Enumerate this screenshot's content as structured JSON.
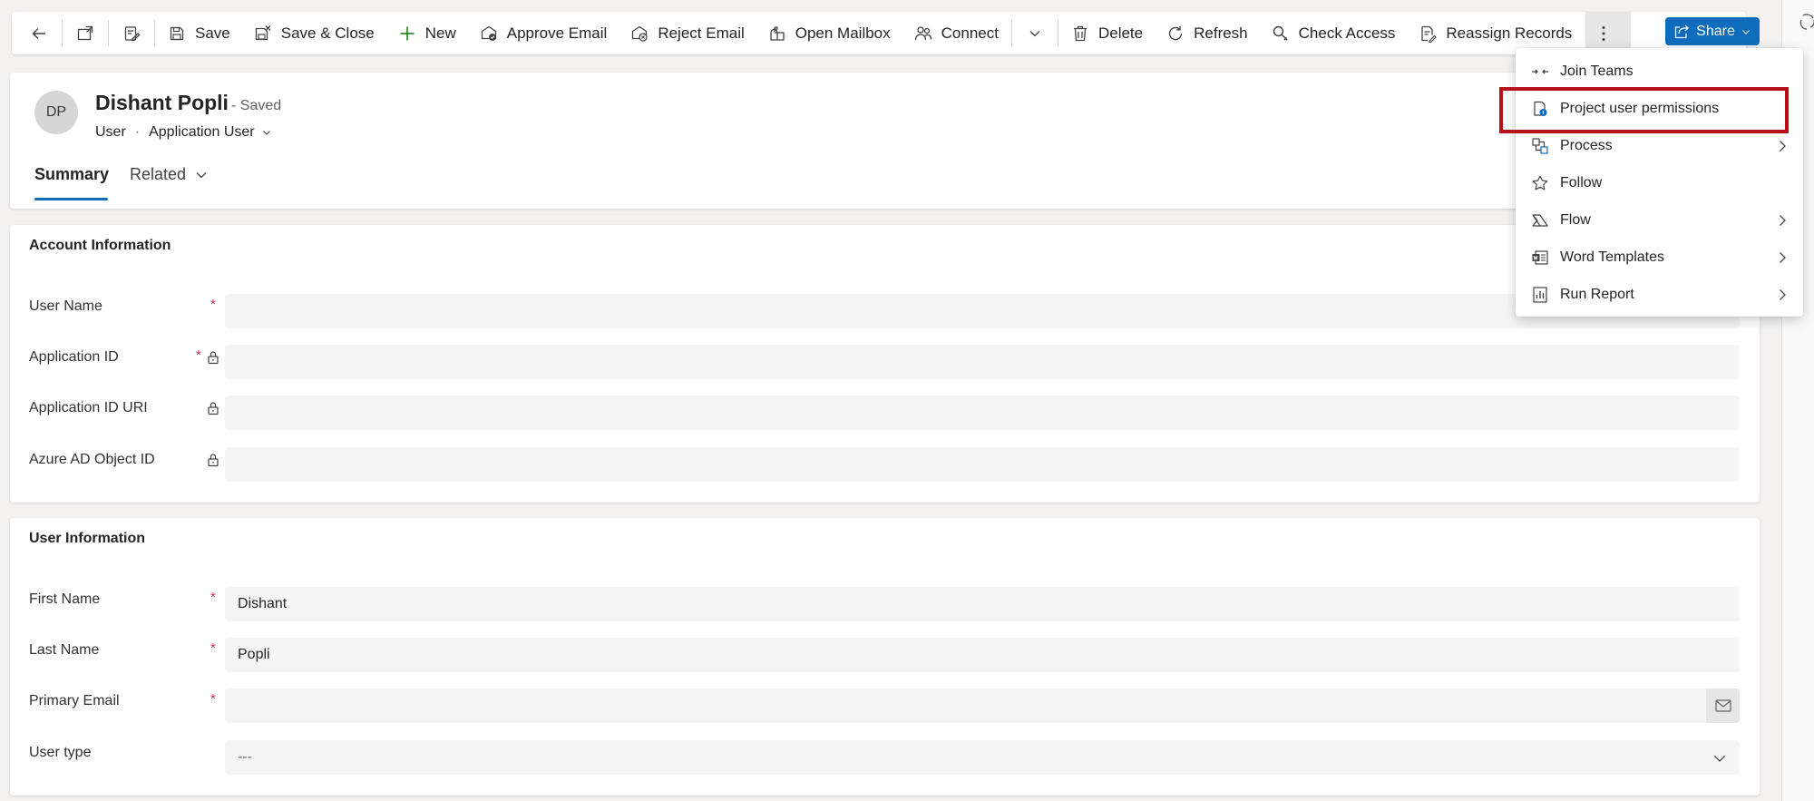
{
  "toolbar": {
    "save": "Save",
    "save_close": "Save & Close",
    "new": "New",
    "approve_email": "Approve Email",
    "reject_email": "Reject Email",
    "open_mailbox": "Open Mailbox",
    "connect": "Connect",
    "delete": "Delete",
    "refresh": "Refresh",
    "check_access": "Check Access",
    "reassign_records": "Reassign Records",
    "share": "Share"
  },
  "record": {
    "initials": "DP",
    "name": "Dishant Popli",
    "status": "- Saved",
    "entity": "User",
    "separator": "·",
    "form": "Application User"
  },
  "tabs": {
    "summary": "Summary",
    "related": "Related"
  },
  "account_section": {
    "title": "Account Information",
    "fields": [
      {
        "label": "User Name",
        "value": "",
        "required": true,
        "locked": false
      },
      {
        "label": "Application ID",
        "value": "",
        "required": true,
        "locked": true
      },
      {
        "label": "Application ID URI",
        "value": "",
        "required": false,
        "locked": true
      },
      {
        "label": "Azure AD Object ID",
        "value": "",
        "required": false,
        "locked": true
      }
    ]
  },
  "user_section": {
    "title": "User Information",
    "fields": [
      {
        "label": "First Name",
        "value": "Dishant",
        "required": true
      },
      {
        "label": "Last Name",
        "value": "Popli",
        "required": true
      },
      {
        "label": "Primary Email",
        "value": "",
        "required": true
      },
      {
        "label": "User type",
        "value": "---",
        "required": false
      }
    ]
  },
  "required_marker": "*",
  "menu": {
    "items": [
      {
        "label": "Join Teams",
        "icon": "join-teams-icon",
        "submenu": false
      },
      {
        "label": "Project user permissions",
        "icon": "permissions-icon",
        "submenu": false,
        "highlighted": true
      },
      {
        "label": "Process",
        "icon": "process-icon",
        "submenu": true
      },
      {
        "label": "Follow",
        "icon": "star-icon",
        "submenu": false
      },
      {
        "label": "Flow",
        "icon": "flow-icon",
        "submenu": true
      },
      {
        "label": "Word Templates",
        "icon": "word-templates-icon",
        "submenu": true
      },
      {
        "label": "Run Report",
        "icon": "report-icon",
        "submenu": true
      }
    ]
  },
  "colors": {
    "accent": "#0f6cbd",
    "required": "#c4314b",
    "highlight": "#b4111b"
  }
}
